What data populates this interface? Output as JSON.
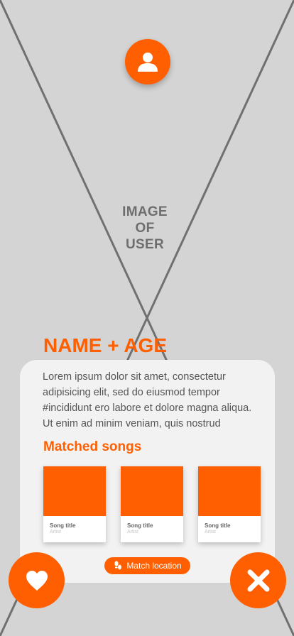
{
  "photo": {
    "placeholder_lines": [
      "IMAGE",
      "OF",
      "USER"
    ]
  },
  "profile": {
    "icon": "user-icon",
    "name_age": "NAME + AGE",
    "bio_lines": [
      "Lorem ipsum dolor sit amet, consectetur",
      "adipisicing elit, sed do eiusmod tempor",
      "#incididunt ero labore et dolore magna aliqua.",
      "Ut enim ad minim veniam, quis nostrud"
    ]
  },
  "matched_songs": {
    "title": "Matched songs",
    "songs": [
      {
        "title": "Song title",
        "artist": "Artist"
      },
      {
        "title": "Song title",
        "artist": "Artist"
      },
      {
        "title": "Song title",
        "artist": "Artist"
      }
    ]
  },
  "match_location": {
    "label": "Match location",
    "icon": "footprints-icon"
  },
  "actions": {
    "like_icon": "heart-icon",
    "dislike_icon": "close-icon"
  },
  "colors": {
    "accent": "#ff5f00",
    "background": "#d4d4d4",
    "card": "#f2f2f2"
  }
}
